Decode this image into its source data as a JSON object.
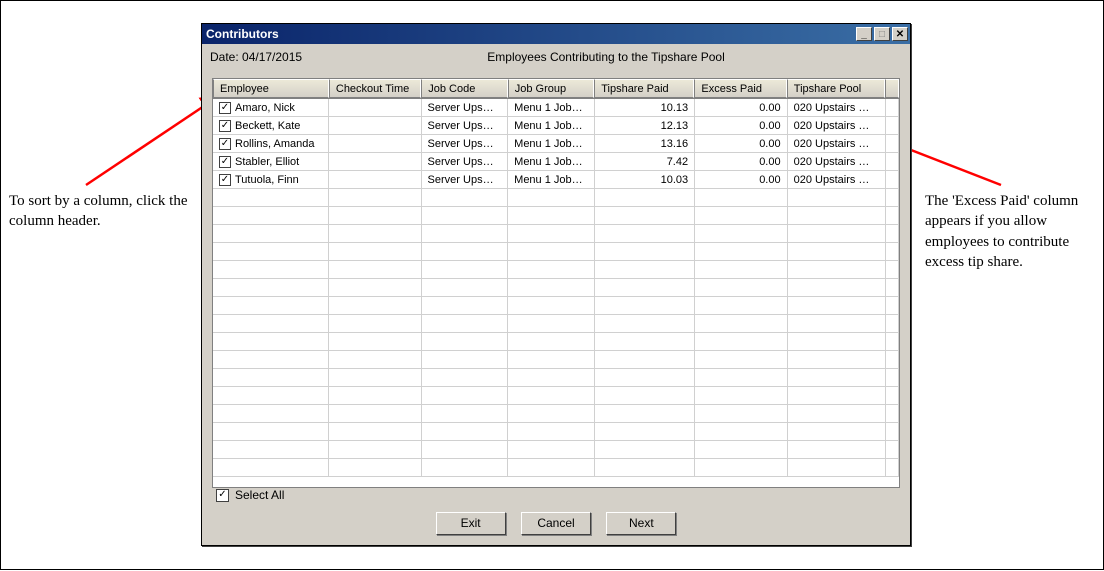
{
  "annotations": {
    "left": "To sort by a column, click the column header.",
    "right": "The 'Excess Paid' column appears if you allow employees to contribute excess tip share."
  },
  "window": {
    "title": "Contributors",
    "date_label": "Date: 04/17/2015",
    "subtitle": "Employees Contributing to the Tipshare Pool"
  },
  "columns": {
    "c1": "Employee",
    "c2": "Checkout Time",
    "c3": "Job Code",
    "c4": "Job Group",
    "c5": "Tipshare Paid",
    "c6": "Excess Paid",
    "c7": "Tipshare Pool"
  },
  "rows": [
    {
      "employee": "Amaro, Nick",
      "checkout": "",
      "jobcode": "Server Ups…",
      "jobgroup": "Menu 1 Job…",
      "tipshare": "10.13",
      "excess": "0.00",
      "pool": "020 Upstairs …"
    },
    {
      "employee": "Beckett, Kate",
      "checkout": "",
      "jobcode": "Server Ups…",
      "jobgroup": "Menu 1 Job…",
      "tipshare": "12.13",
      "excess": "0.00",
      "pool": "020 Upstairs …"
    },
    {
      "employee": "Rollins, Amanda",
      "checkout": "",
      "jobcode": "Server Ups…",
      "jobgroup": "Menu 1 Job…",
      "tipshare": "13.16",
      "excess": "0.00",
      "pool": "020 Upstairs …"
    },
    {
      "employee": "Stabler, Elliot",
      "checkout": "",
      "jobcode": "Server Ups…",
      "jobgroup": "Menu 1 Job…",
      "tipshare": "7.42",
      "excess": "0.00",
      "pool": "020 Upstairs …"
    },
    {
      "employee": "Tutuola, Finn",
      "checkout": "",
      "jobcode": "Server Ups…",
      "jobgroup": "Menu 1 Job…",
      "tipshare": "10.03",
      "excess": "0.00",
      "pool": "020 Upstairs …"
    }
  ],
  "select_all_label": "Select All",
  "buttons": {
    "exit": "Exit",
    "cancel": "Cancel",
    "next": "Next"
  }
}
